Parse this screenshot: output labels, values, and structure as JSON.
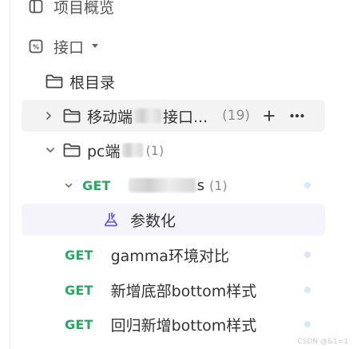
{
  "colors": {
    "get": "#2aa665",
    "accent": "#6e5bd6",
    "dot": "#d7e8fb"
  },
  "nav": {
    "overview_label": "项目概览",
    "api_label": "接口"
  },
  "tree": {
    "root": {
      "label": "根目录"
    },
    "folder_mobile": {
      "label_a": "移动端",
      "label_b": "接口...",
      "count": "(19)"
    },
    "folder_pc": {
      "label": "pc端",
      "count": "(1)"
    },
    "api_s": {
      "method": "GET",
      "label_tail": "s",
      "count": "(1)"
    },
    "param": {
      "label": "参数化"
    },
    "apis": [
      {
        "method": "GET",
        "label": "gamma环境对比"
      },
      {
        "method": "GET",
        "label": "新增底部bottom样式"
      },
      {
        "method": "GET",
        "label": "回归新增bottom样式"
      }
    ]
  },
  "watermark": "CSDN @&1=1"
}
